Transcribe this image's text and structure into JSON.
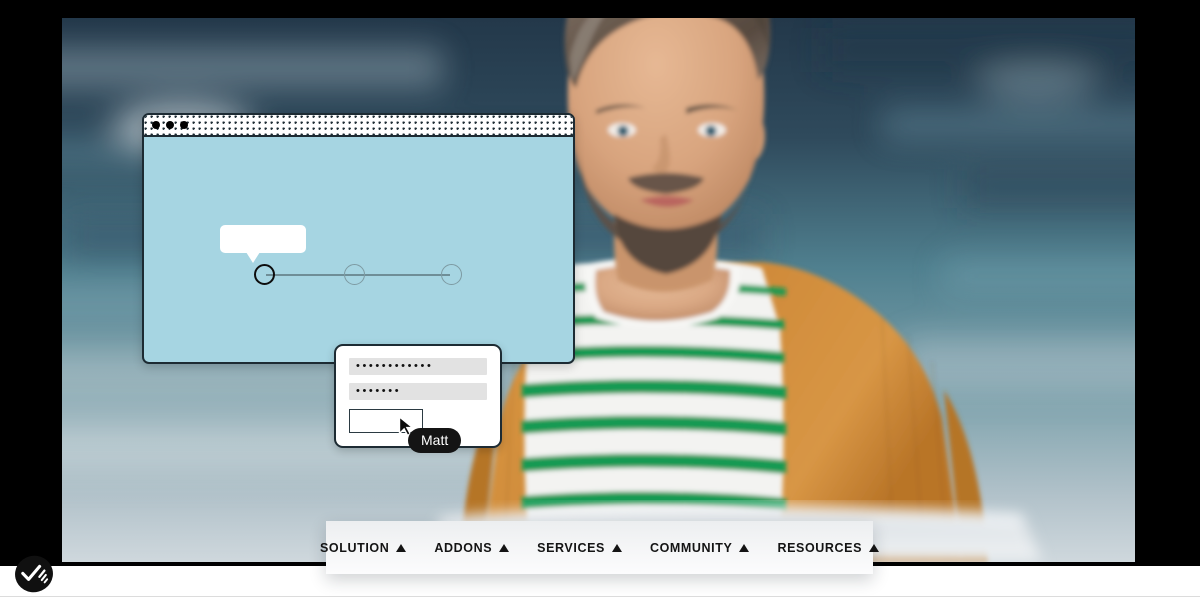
{
  "scene": {
    "description": "Hero illustration: blurred photo of a bearded man in an orange cardigan and green-striped shirt working on a laptop, overlaid with UI mockups.",
    "frame_color": "#000000",
    "page_background": "#ffffff"
  },
  "photo": {
    "alt": "Smiling bearded man in mustard cardigan and green striped shirt looking at a laptop",
    "colors": {
      "background_blur_dark": "#2b4152",
      "background_blur_teal": "#4f7f92",
      "background_blur_light": "#b9c6cd",
      "cardigan_orange": "#d18b3c",
      "cardigan_orange_shadow": "#ab6d2c",
      "shirt_white": "#f4f4f2",
      "shirt_green": "#139a52",
      "skin": "#dba882",
      "skin_shadow": "#b9835f",
      "hair": "#6a5a4e",
      "hair_light": "#9b8e82",
      "beard": "#5d4f45",
      "laptop_silver": "#dfe2e4"
    }
  },
  "browser_mock": {
    "name": "browser-window-mockup",
    "titlebar": {
      "pattern": "halftone-dots",
      "traffic_lights": [
        "dot-1",
        "dot-2",
        "dot-3"
      ]
    },
    "canvas_color": "#a6d5e2",
    "border_color": "#1d2b33",
    "tooltip_bubble": {
      "name": "empty-tooltip-bubble",
      "text": "",
      "fill": "#ffffff"
    },
    "stepper": {
      "name": "three-step-progress",
      "steps": [
        {
          "label": "",
          "state": "active",
          "color": "#0d0d0d"
        },
        {
          "label": "",
          "state": "inactive",
          "color": "#7d9aa2"
        },
        {
          "label": "",
          "state": "inactive",
          "color": "#7d9aa2"
        }
      ],
      "track_color": "#6f8e97"
    }
  },
  "form_card": {
    "name": "login-form-mockup",
    "fields": [
      {
        "name": "username-field",
        "masked_value": "••••••••••••",
        "dots": 12,
        "fill": "#e2e2e2"
      },
      {
        "name": "password-field",
        "masked_value": "•••••••",
        "dots": 7,
        "fill": "#e2e2e2"
      }
    ],
    "submit_button": {
      "label": "",
      "border_color": "#2b3a42"
    },
    "cursor": {
      "icon": "mouse-cursor-arrow"
    },
    "name_pill": {
      "label": "Matt",
      "background": "#141414",
      "text_color": "#ffffff"
    },
    "border_color": "#1d2b33"
  },
  "navbar": {
    "name": "main-navigation",
    "background": "#f4f5f6",
    "text_color": "#141414",
    "items": [
      {
        "label": "SOLUTION",
        "caret": "caret-up-icon"
      },
      {
        "label": "ADDONS",
        "caret": "caret-up-icon"
      },
      {
        "label": "SERVICES",
        "caret": "caret-up-icon"
      },
      {
        "label": "COMMUNITY",
        "caret": "caret-up-icon"
      },
      {
        "label": "RESOURCES",
        "caret": "caret-up-icon"
      }
    ]
  },
  "logo_badge": {
    "name": "checkmark-swoosh-logo",
    "icon": "check-swoosh-icon",
    "background": "#101010",
    "mark_color": "#ffffff",
    "label": ""
  }
}
